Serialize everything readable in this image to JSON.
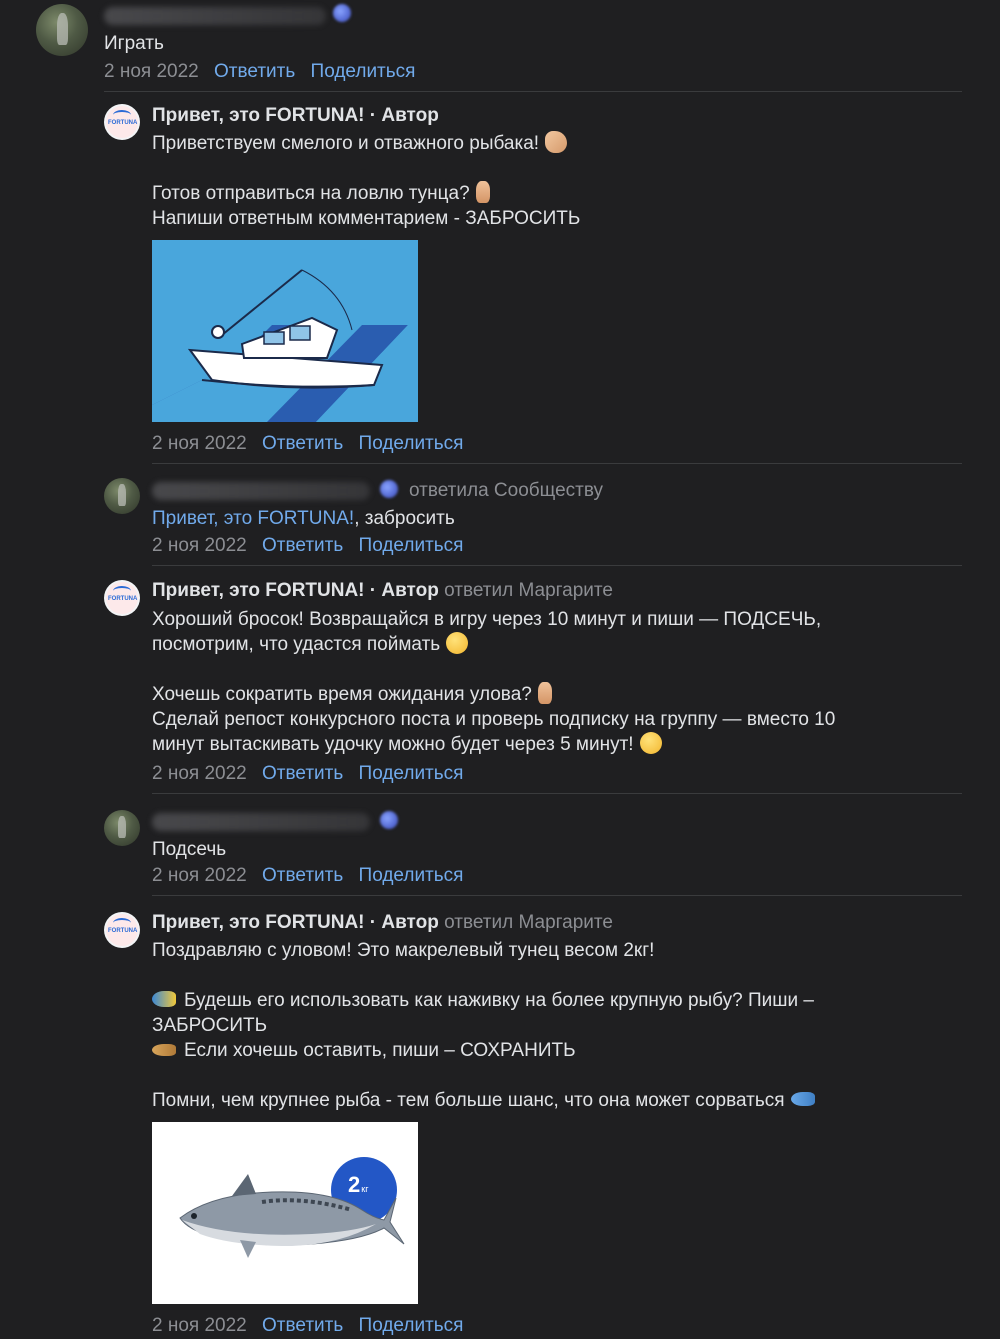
{
  "thread": {
    "root": {
      "author_masked": true,
      "text": "Играть",
      "date": "2 ноя 2022",
      "reply_label": "Ответить",
      "share_label": "Поделиться"
    },
    "replies": [
      {
        "author": "Привет, это FORTUNA!",
        "author_suffix": " · Автор",
        "lines": [
          "Приветствуем смелого и отважного рыбака!",
          "",
          "Готов отправиться на ловлю тунца?",
          "Напиши ответным комментарием - ЗАБРОСИТЬ"
        ],
        "date": "2 ноя 2022",
        "reply_label": "Ответить",
        "share_label": "Поделиться"
      },
      {
        "author_masked": true,
        "reply_to": "ответила Сообществу",
        "mention": "Привет, это FORTUNA!",
        "text": ", забросить",
        "date": "2 ноя 2022",
        "reply_label": "Ответить",
        "share_label": "Поделиться"
      },
      {
        "author": "Привет, это FORTUNA!",
        "author_suffix": " · Автор",
        "reply_to": "ответил Маргарите",
        "lines": [
          "Хороший бросок! Возвращайся в игру через 10 минут и пиши — ПОДСЕЧЬ,",
          "посмотрим, что удастся поймать",
          "",
          "Хочешь сократить время ожидания улова?",
          "Сделай репост конкурсного поста и проверь подписку на группу — вместо 10",
          "минут вытаскивать удочку можно будет через 5 минут!"
        ],
        "date": "2 ноя 2022",
        "reply_label": "Ответить",
        "share_label": "Поделиться"
      },
      {
        "author_masked": true,
        "text": "Подсечь",
        "date": "2 ноя 2022",
        "reply_label": "Ответить",
        "share_label": "Поделиться"
      },
      {
        "author": "Привет, это FORTUNA!",
        "author_suffix": " · Автор",
        "reply_to": "ответил Маргарите",
        "lines": [
          "Поздравляю с уловом! Это макрелевый тунец весом 2кг!",
          "",
          "Будешь его использовать как наживку на более крупную рыбу? Пиши –",
          "ЗАБРОСИТЬ",
          "Если хочешь оставить, пиши – СОХРАНИТЬ",
          "",
          "Помни, чем крупнее рыба - тем больше шанс, что она может сорваться"
        ],
        "image_badge_number": "2",
        "image_badge_unit": "кг",
        "date": "2 ноя 2022",
        "reply_label": "Ответить",
        "share_label": "Поделиться"
      }
    ]
  },
  "brand_logo_text": "FORTUNA",
  "colors": {
    "background": "#1f1f21",
    "text": "#e1e3e6",
    "muted": "#8c8e93",
    "link": "#71aaeb",
    "separator": "#3a3b3d",
    "image_bg_boat": "#49a6dc",
    "badge": "#2357c6"
  },
  "icons": {
    "emoji_1": "flexed-biceps",
    "emoji_2": "backhand-index-pointing-down",
    "emoji_3": "winking-face",
    "emoji_4": "zany-face",
    "emoji_5": "tropical-fish",
    "emoji_6": "blowfish",
    "emoji_7": "fish"
  }
}
